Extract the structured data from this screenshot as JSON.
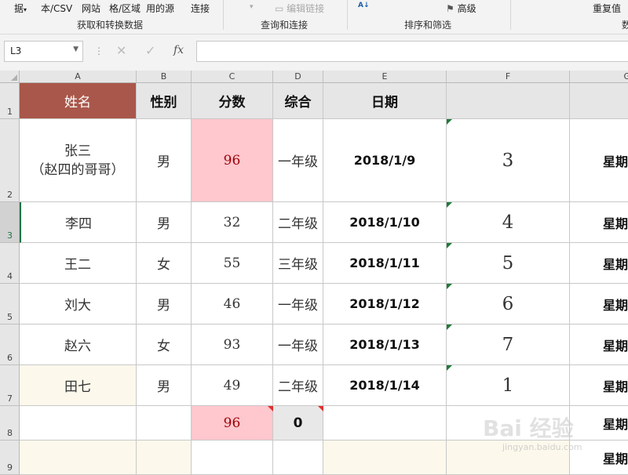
{
  "ribbon": {
    "items": [
      {
        "label": "据",
        "dd": "▾"
      },
      {
        "label": "本/CSV"
      },
      {
        "label": "网站"
      },
      {
        "label": "格/区域"
      },
      {
        "label": "用的源"
      },
      {
        "label": "连接"
      },
      {
        "label": "编辑链接"
      },
      {
        "label": "高级"
      },
      {
        "label": "重复值"
      }
    ],
    "groups": [
      "获取和转换数据",
      "查询和连接",
      "排序和筛选",
      "数"
    ],
    "sort_icon": "A↓"
  },
  "formula_bar": {
    "name_box": "L3",
    "cancel": "✕",
    "enter": "✓",
    "fx": "fx",
    "formula": ""
  },
  "columns": [
    "A",
    "B",
    "C",
    "D",
    "E",
    "F",
    "G"
  ],
  "rows": [
    "1",
    "2",
    "3",
    "4",
    "5",
    "6",
    "7",
    "8",
    "9"
  ],
  "headers": {
    "name": "姓名",
    "gender": "性别",
    "score": "分数",
    "summary": "综合",
    "date": "日期"
  },
  "data_rows": [
    {
      "name": "张三",
      "name2": "（赵四的哥哥）",
      "gender": "男",
      "score": "96",
      "grade": "一年级",
      "date": "2018/1/9",
      "num": "3",
      "weekday": "星期"
    },
    {
      "name": "李四",
      "gender": "男",
      "score": "32",
      "grade": "二年级",
      "date": "2018/1/10",
      "num": "4",
      "weekday": "星期"
    },
    {
      "name": "王二",
      "gender": "女",
      "score": "55",
      "grade": "三年级",
      "date": "2018/1/11",
      "num": "5",
      "weekday": "星期"
    },
    {
      "name": "刘大",
      "gender": "男",
      "score": "46",
      "grade": "一年级",
      "date": "2018/1/12",
      "num": "6",
      "weekday": "星期"
    },
    {
      "name": "赵六",
      "gender": "女",
      "score": "93",
      "grade": "一年级",
      "date": "2018/1/13",
      "num": "7",
      "weekday": "星期"
    },
    {
      "name": "田七",
      "gender": "男",
      "score": "49",
      "grade": "二年级",
      "date": "2018/1/14",
      "num": "1",
      "weekday": "星期"
    }
  ],
  "row8": {
    "score": "96",
    "summary": "0",
    "weekday": "星期"
  },
  "row9": {
    "weekday": "星期"
  },
  "watermark": {
    "text": "Bai 经验",
    "sub": "jingyan.baidu.com"
  },
  "colors": {
    "name_header_fill": "#a9574a",
    "highlight_pink": "#ffc7ce",
    "pale_yellow": "#fcf8ec",
    "gray_fill": "#e8e8e8",
    "header_gray": "#e7e6e6"
  }
}
